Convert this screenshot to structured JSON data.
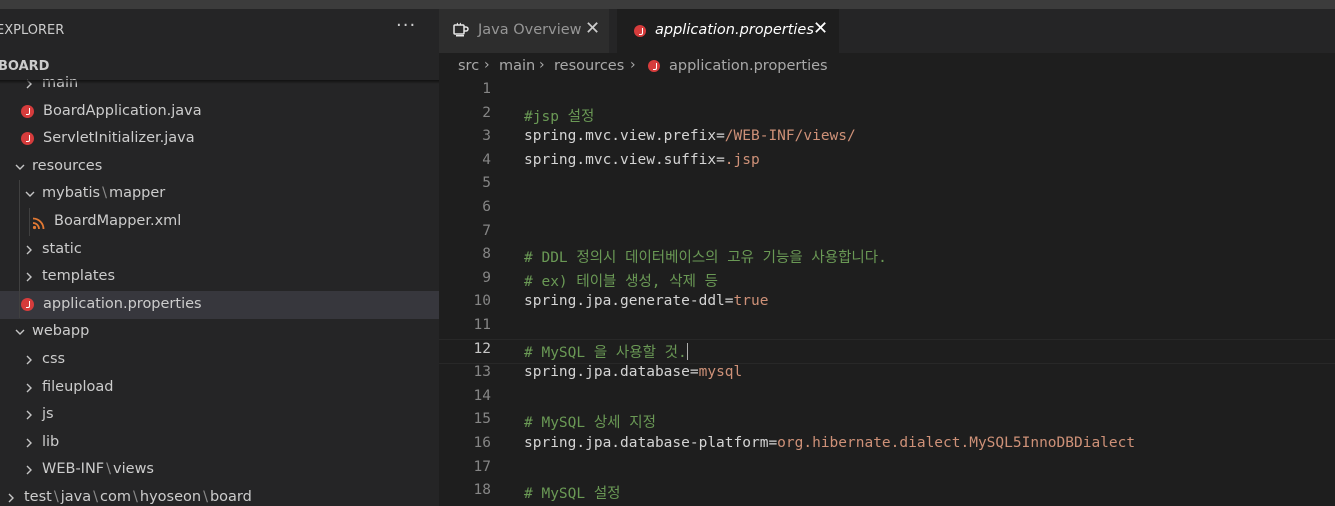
{
  "sidebar": {
    "title": "EXPLORER",
    "more_icon": "ellipsis-icon",
    "section_title": "BOARD",
    "items": [
      {
        "label": "main",
        "type": "folder",
        "expanded": false,
        "depth": 2
      },
      {
        "label": "BoardApplication.java",
        "type": "java",
        "depth": 2
      },
      {
        "label": "ServletInitializer.java",
        "type": "java",
        "depth": 2
      },
      {
        "label": "resources",
        "type": "folder",
        "expanded": true,
        "depth": 1
      },
      {
        "label_parts": [
          "mybatis",
          "mapper"
        ],
        "type": "folder",
        "expanded": true,
        "depth": 2
      },
      {
        "label": "BoardMapper.xml",
        "type": "xml",
        "depth": 3
      },
      {
        "label": "static",
        "type": "folder",
        "expanded": false,
        "depth": 2
      },
      {
        "label": "templates",
        "type": "folder",
        "expanded": false,
        "depth": 2
      },
      {
        "label": "application.properties",
        "type": "properties",
        "depth": 2,
        "selected": true
      },
      {
        "label": "webapp",
        "type": "folder",
        "expanded": true,
        "depth": 1
      },
      {
        "label": "css",
        "type": "folder",
        "expanded": false,
        "depth": 2
      },
      {
        "label": "fileupload",
        "type": "folder",
        "expanded": false,
        "depth": 2
      },
      {
        "label": "js",
        "type": "folder",
        "expanded": false,
        "depth": 2
      },
      {
        "label": "lib",
        "type": "folder",
        "expanded": false,
        "depth": 2
      },
      {
        "label_parts": [
          "WEB-INF",
          "views"
        ],
        "type": "folder",
        "expanded": false,
        "depth": 2
      },
      {
        "label_parts": [
          "test",
          "java",
          "com",
          "hyoseon",
          "board"
        ],
        "type": "folder",
        "expanded": false,
        "depth": 0
      }
    ]
  },
  "tabs": [
    {
      "label": "Java Overview",
      "icon": "java-overview-icon",
      "active": false,
      "close": "✕"
    },
    {
      "label": "application.properties",
      "icon": "java-icon",
      "active": true,
      "close": "✕"
    }
  ],
  "breadcrumb": [
    "src",
    "main",
    "resources",
    "application.properties"
  ],
  "editor": {
    "current_line": 12,
    "lines": [
      {
        "n": "1",
        "tokens": []
      },
      {
        "n": "2",
        "tokens": [
          {
            "t": "#jsp 설정",
            "c": "comment"
          }
        ]
      },
      {
        "n": "3",
        "tokens": [
          {
            "t": "spring.mvc.view.prefix",
            "c": "key"
          },
          {
            "t": "=",
            "c": "op"
          },
          {
            "t": "/WEB-INF/views/",
            "c": "val"
          }
        ]
      },
      {
        "n": "4",
        "tokens": [
          {
            "t": "spring.mvc.view.suffix",
            "c": "key"
          },
          {
            "t": "=",
            "c": "op"
          },
          {
            "t": ".jsp",
            "c": "val"
          }
        ]
      },
      {
        "n": "5",
        "tokens": []
      },
      {
        "n": "6",
        "tokens": []
      },
      {
        "n": "7",
        "tokens": []
      },
      {
        "n": "8",
        "tokens": [
          {
            "t": "# DDL 정의시 데이터베이스의 고유 기능을 사용합니다.",
            "c": "comment"
          }
        ]
      },
      {
        "n": "9",
        "tokens": [
          {
            "t": "# ex) 테이블 생성, 삭제 등",
            "c": "comment"
          }
        ]
      },
      {
        "n": "10",
        "tokens": [
          {
            "t": "spring.jpa.generate-ddl",
            "c": "key"
          },
          {
            "t": "=",
            "c": "op"
          },
          {
            "t": "true",
            "c": "val"
          }
        ]
      },
      {
        "n": "11",
        "tokens": []
      },
      {
        "n": "12",
        "tokens": [
          {
            "t": "# MySQL 을 사용할 것.",
            "c": "comment"
          }
        ]
      },
      {
        "n": "13",
        "tokens": [
          {
            "t": "spring.jpa.database",
            "c": "key"
          },
          {
            "t": "=",
            "c": "op"
          },
          {
            "t": "mysql",
            "c": "val"
          }
        ]
      },
      {
        "n": "14",
        "tokens": []
      },
      {
        "n": "15",
        "tokens": [
          {
            "t": "# MySQL 상세 지정",
            "c": "comment"
          }
        ]
      },
      {
        "n": "16",
        "tokens": [
          {
            "t": "spring.jpa.database-platform",
            "c": "key"
          },
          {
            "t": "=",
            "c": "op"
          },
          {
            "t": "org.hibernate.dialect.MySQL5InnoDBDialect",
            "c": "val"
          }
        ]
      },
      {
        "n": "17",
        "tokens": []
      },
      {
        "n": "18",
        "tokens": [
          {
            "t": "# MySQL 설정",
            "c": "comment"
          }
        ]
      }
    ]
  },
  "colors": {
    "comment": "#6a9955",
    "value": "#ce9178",
    "java_icon": "#d63c3c",
    "xml_icon": "#e37933"
  }
}
